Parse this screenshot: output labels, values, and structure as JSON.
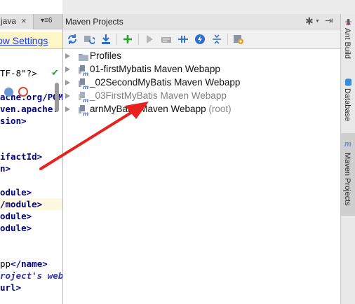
{
  "editor": {
    "tab_label": "java",
    "tab_close": "×",
    "tab_list_label": "▾≡6",
    "notification_link": "ow Settings",
    "code_lines": [
      {
        "parts": [
          {
            "cls": "txt",
            "t": "TF-8\"?>"
          }
        ],
        "hl": false
      },
      {
        "parts": [],
        "hl": false
      },
      {
        "parts": [
          {
            "cls": "url",
            "t": "ache.org/POM"
          }
        ],
        "hl": false
      },
      {
        "parts": [
          {
            "cls": "url",
            "t": "ven.apache."
          }
        ],
        "hl": false
      },
      {
        "parts": [
          {
            "cls": "tag",
            "t": "sion>"
          }
        ],
        "hl": false
      },
      {
        "parts": [],
        "hl": false
      },
      {
        "parts": [],
        "hl": false
      },
      {
        "parts": [
          {
            "cls": "tag",
            "t": "ifactId>"
          }
        ],
        "hl": false
      },
      {
        "parts": [
          {
            "cls": "tag",
            "t": "n>"
          }
        ],
        "hl": false
      },
      {
        "parts": [],
        "hl": false
      },
      {
        "parts": [
          {
            "cls": "tag",
            "t": "odule>"
          }
        ],
        "hl": false
      },
      {
        "parts": [
          {
            "cls": "tag",
            "t": "/module>"
          }
        ],
        "hl": true
      },
      {
        "parts": [
          {
            "cls": "tag",
            "t": "odule>"
          }
        ],
        "hl": false
      },
      {
        "parts": [
          {
            "cls": "tag",
            "t": "odule>"
          }
        ],
        "hl": false
      },
      {
        "parts": [],
        "hl": false
      },
      {
        "parts": [],
        "hl": false
      },
      {
        "parts": [
          {
            "cls": "txt",
            "t": "pp"
          },
          {
            "cls": "tag",
            "t": "</name>"
          }
        ],
        "hl": false
      },
      {
        "parts": [
          {
            "cls": "cmt",
            "t": "roject's web"
          }
        ],
        "hl": false
      },
      {
        "parts": [
          {
            "cls": "tag",
            "t": "url>"
          }
        ],
        "hl": false
      }
    ]
  },
  "maven_panel": {
    "title": "Maven Projects",
    "toolbar_icons": [
      "reimport-icon",
      "generate-sources-icon",
      "download-icon",
      "add-icon",
      "run-icon",
      "execute-goal-icon",
      "toggle-offline-icon",
      "skip-tests-icon",
      "collapse-all-icon",
      "settings-icon"
    ],
    "tree": [
      {
        "label": "Profiles",
        "extra": "",
        "icon": "folder-icon",
        "dim": false
      },
      {
        "label": "01-firstMybatis Maven Webapp",
        "extra": "",
        "icon": "maven-module-icon",
        "dim": false
      },
      {
        "label": "_02SecondMyBatis Maven Webapp",
        "extra": "",
        "icon": "maven-module-icon",
        "dim": false
      },
      {
        "label": "_03FirstMyBatis Maven Webapp",
        "extra": "",
        "icon": "maven-module-icon",
        "dim": true
      },
      {
        "label": "arnMyBatis Maven Webapp",
        "extra": "(root)",
        "icon": "maven-module-icon",
        "dim": false
      }
    ]
  },
  "right_strip": {
    "tools": [
      {
        "label": "Ant Build",
        "icon": "ant-icon",
        "active": false
      },
      {
        "label": "Database",
        "icon": "database-icon",
        "active": false
      },
      {
        "label": "Maven Projects",
        "icon": "maven-icon",
        "active": true
      }
    ]
  },
  "colors": {
    "annotation_arrow": "#e8211f",
    "link": "#1a3aff",
    "xml_tag": "#000080"
  }
}
